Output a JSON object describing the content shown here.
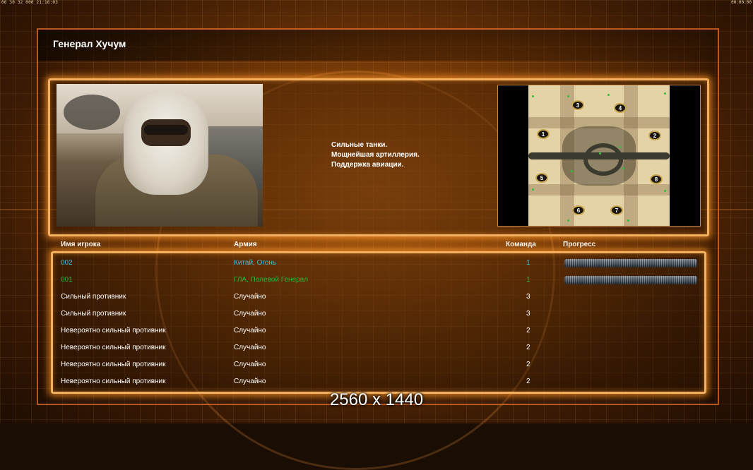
{
  "topbar": {
    "left": "06 30 32 000 21:16:03",
    "right": "00:00:00"
  },
  "general": {
    "name": "Генерал Хучум",
    "description": [
      "Сильные танки.",
      "Мощнейшая артиллерия.",
      "Поддержка авиации."
    ]
  },
  "minimap": {
    "start_positions": [
      "1",
      "2",
      "3",
      "4",
      "5",
      "6",
      "7",
      "8"
    ]
  },
  "columns": {
    "name": "Имя игрока",
    "army": "Армия",
    "team": "Команда",
    "progress": "Прогресс"
  },
  "players": [
    {
      "name": "002",
      "army": "Китай, Огонь",
      "team": "1",
      "color": "#39c6d6",
      "progress": 1.0
    },
    {
      "name": "001",
      "army": "ГЛА, Полевой Генерал",
      "team": "1",
      "color": "#2db33a",
      "progress": 1.0
    },
    {
      "name": "Сильный противник",
      "army": "Случайно",
      "team": "3",
      "color": "#ffffff"
    },
    {
      "name": "Сильный противник",
      "army": "Случайно",
      "team": "3",
      "color": "#ffffff"
    },
    {
      "name": "Невероятно сильный противник",
      "army": "Случайно",
      "team": "2",
      "color": "#ffffff"
    },
    {
      "name": "Невероятно сильный противник",
      "army": "Случайно",
      "team": "2",
      "color": "#ffffff"
    },
    {
      "name": "Невероятно сильный противник",
      "army": "Случайно",
      "team": "2",
      "color": "#ffffff"
    },
    {
      "name": "Невероятно сильный противник",
      "army": "Случайно",
      "team": "2",
      "color": "#ffffff"
    }
  ],
  "watermark": "2560 x 1440",
  "colors": {
    "accent": "#f3b060",
    "frame": "#e66e28"
  }
}
